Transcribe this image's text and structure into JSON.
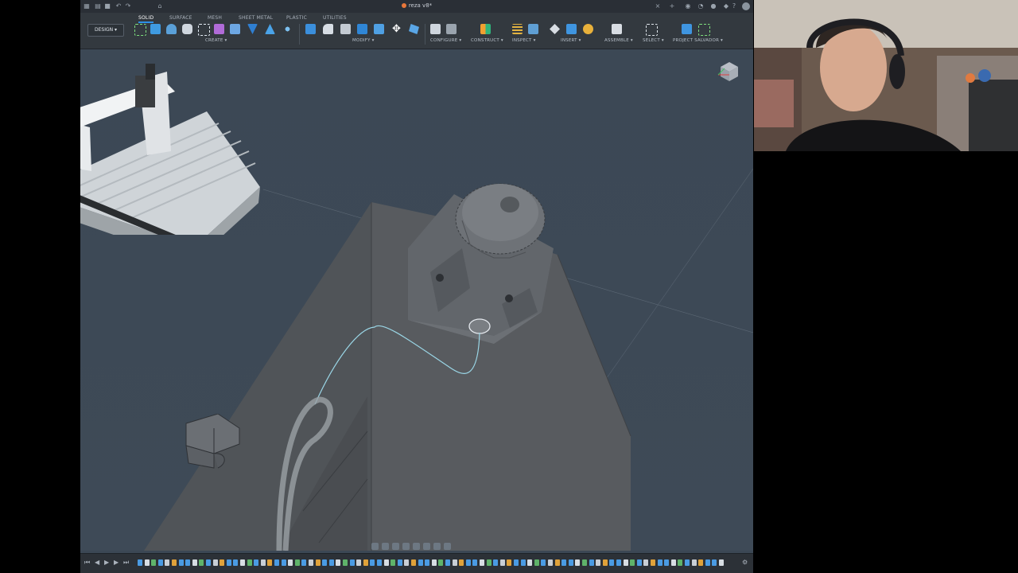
{
  "window": {
    "title": "reza v8*"
  },
  "workspace_button": "DESIGN",
  "tabs": [
    {
      "label": "SOLID",
      "active": true
    },
    {
      "label": "SURFACE",
      "active": false
    },
    {
      "label": "MESH",
      "active": false
    },
    {
      "label": "SHEET METAL",
      "active": false
    },
    {
      "label": "PLASTIC",
      "active": false
    },
    {
      "label": "UTILITIES",
      "active": false
    }
  ],
  "groups": {
    "create": "CREATE",
    "modify": "MODIFY",
    "configure": "CONFIGURE",
    "construct": "CONSTRUCT",
    "inspect": "INSPECT",
    "insert": "INSERT",
    "assemble": "ASSEMBLE",
    "select": "SELECT",
    "project": "PROJECT SALVADOR"
  },
  "colors": {
    "accent": "#2e8fe6",
    "viewport_bg": "#3c4855",
    "model_body": "#585b5f",
    "path_curve": "#9ad6e6"
  },
  "icons": {
    "timeline_controls": [
      "skip-start-icon",
      "step-back-icon",
      "play-icon",
      "step-forward-icon",
      "skip-end-icon"
    ],
    "settings": "gear-icon"
  }
}
